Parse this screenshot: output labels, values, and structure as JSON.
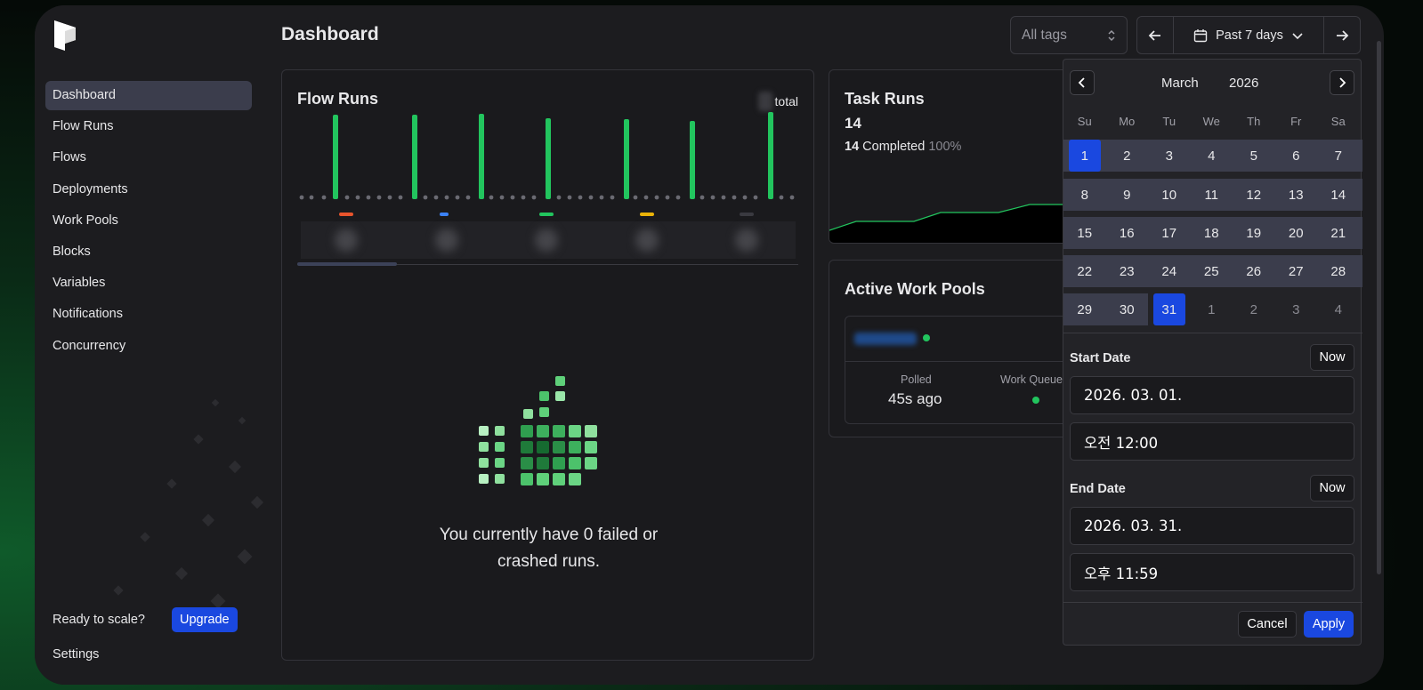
{
  "sidebar": {
    "items": [
      {
        "label": "Dashboard",
        "active": true
      },
      {
        "label": "Flow Runs"
      },
      {
        "label": "Flows"
      },
      {
        "label": "Deployments"
      },
      {
        "label": "Work Pools"
      },
      {
        "label": "Blocks"
      },
      {
        "label": "Variables"
      },
      {
        "label": "Notifications"
      },
      {
        "label": "Concurrency"
      }
    ],
    "scale_text": "Ready to scale?",
    "upgrade_label": "Upgrade",
    "settings_label": "Settings"
  },
  "header": {
    "title": "Dashboard",
    "tags_placeholder": "All tags",
    "date_range_label": "Past 7 days"
  },
  "flow_runs": {
    "title": "Flow Runs",
    "total_label": "total",
    "empty_message_line1": "You currently have 0 failed or",
    "empty_message_line2": "crashed runs.",
    "chip_colors": [
      "#e8542c",
      "#3b82f6",
      "#22c55e",
      "#eab308",
      "#3a3a40"
    ]
  },
  "task_runs": {
    "title": "Task Runs",
    "count": "14",
    "completed_count": "14",
    "completed_label": "Completed",
    "completed_pct": "100%"
  },
  "work_pools": {
    "title": "Active Work Pools",
    "polled_label": "Polled",
    "polled_value": "45s ago",
    "work_queues_label": "Work Queues"
  },
  "calendar": {
    "month": "March",
    "year": "2026",
    "weekdays": [
      "Su",
      "Mo",
      "Tu",
      "We",
      "Th",
      "Fr",
      "Sa"
    ],
    "weeks": [
      [
        "1",
        "2",
        "3",
        "4",
        "5",
        "6",
        "7"
      ],
      [
        "8",
        "9",
        "10",
        "11",
        "12",
        "13",
        "14"
      ],
      [
        "15",
        "16",
        "17",
        "18",
        "19",
        "20",
        "21"
      ],
      [
        "22",
        "23",
        "24",
        "25",
        "26",
        "27",
        "28"
      ],
      [
        "29",
        "30",
        "31",
        "1",
        "2",
        "3",
        "4"
      ]
    ],
    "selected_days": [
      "1",
      "31"
    ],
    "start_label": "Start Date",
    "start_date": "2026. 03. 01.",
    "start_time": "오전 12:00",
    "end_label": "End Date",
    "end_date": "2026. 03. 31.",
    "end_time": "오후 11:59",
    "now_label": "Now",
    "cancel_label": "Cancel",
    "apply_label": "Apply"
  },
  "colors": {
    "accent": "#1a48e0",
    "success": "#22c55e",
    "sidebar_active": "#3b3d4c"
  }
}
